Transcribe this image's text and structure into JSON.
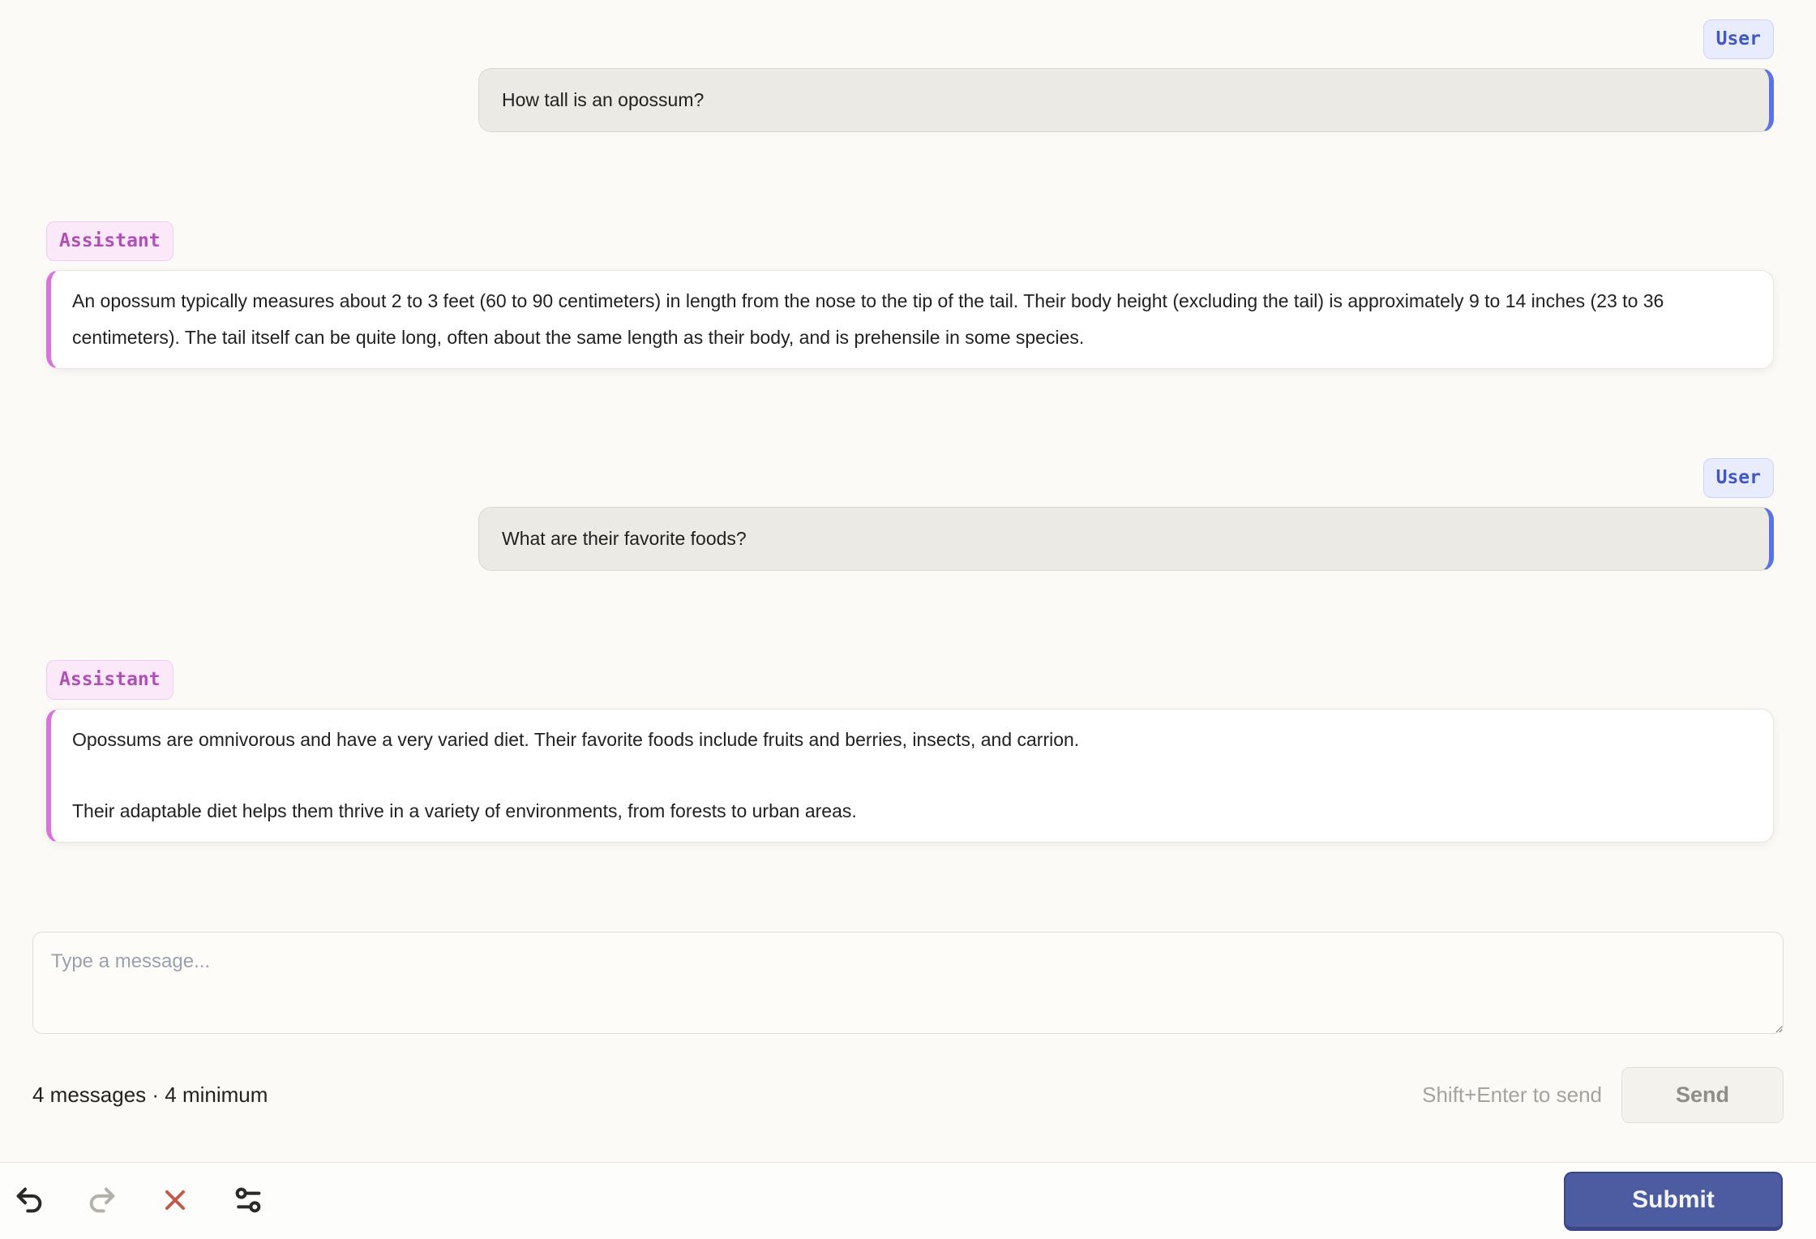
{
  "badges": {
    "user": "User",
    "assistant": "Assistant"
  },
  "messages": [
    {
      "role": "user",
      "label": "User",
      "text": "How tall is an opossum?"
    },
    {
      "role": "assistant",
      "label": "Assistant",
      "paragraphs": [
        "An opossum typically measures about 2 to 3 feet (60 to 90 centimeters) in length from the nose to the tip of the tail. Their body height (excluding the tail) is approximately 9 to 14 inches (23 to 36 centimeters). The tail itself can be quite long, often about the same length as their body, and is prehensile in some species."
      ]
    },
    {
      "role": "user",
      "label": "User",
      "text": "What are their favorite foods?"
    },
    {
      "role": "assistant",
      "label": "Assistant",
      "paragraphs": [
        "Opossums are omnivorous and have a very varied diet. Their favorite foods include fruits and berries, insects, and carrion.",
        "Their adaptable diet helps them thrive in a variety of environments, from forests to urban areas."
      ]
    }
  ],
  "composer": {
    "placeholder": "Type a message...",
    "status": "4 messages · 4 minimum",
    "hint": "Shift+Enter to send",
    "send_label": "Send"
  },
  "toolbar": {
    "submit_label": "Submit",
    "icons": [
      "undo-icon",
      "redo-icon",
      "close-icon",
      "sliders-icon"
    ]
  },
  "colors": {
    "page_bg": "#fbfaf7",
    "user_accent": "#5b73e3",
    "user_badge_text": "#4157c4",
    "user_badge_bg": "#e9ecfc",
    "user_bubble_bg": "#eceae4",
    "assistant_accent": "#d873da",
    "assistant_badge_text": "#b04fb4",
    "assistant_badge_bg": "#fbe9fa",
    "submit_bg": "#4d5ba1",
    "close_icon": "#c05a49",
    "undo_icon": "#2a2927",
    "redo_icon_disabled": "#b3b1aa"
  }
}
